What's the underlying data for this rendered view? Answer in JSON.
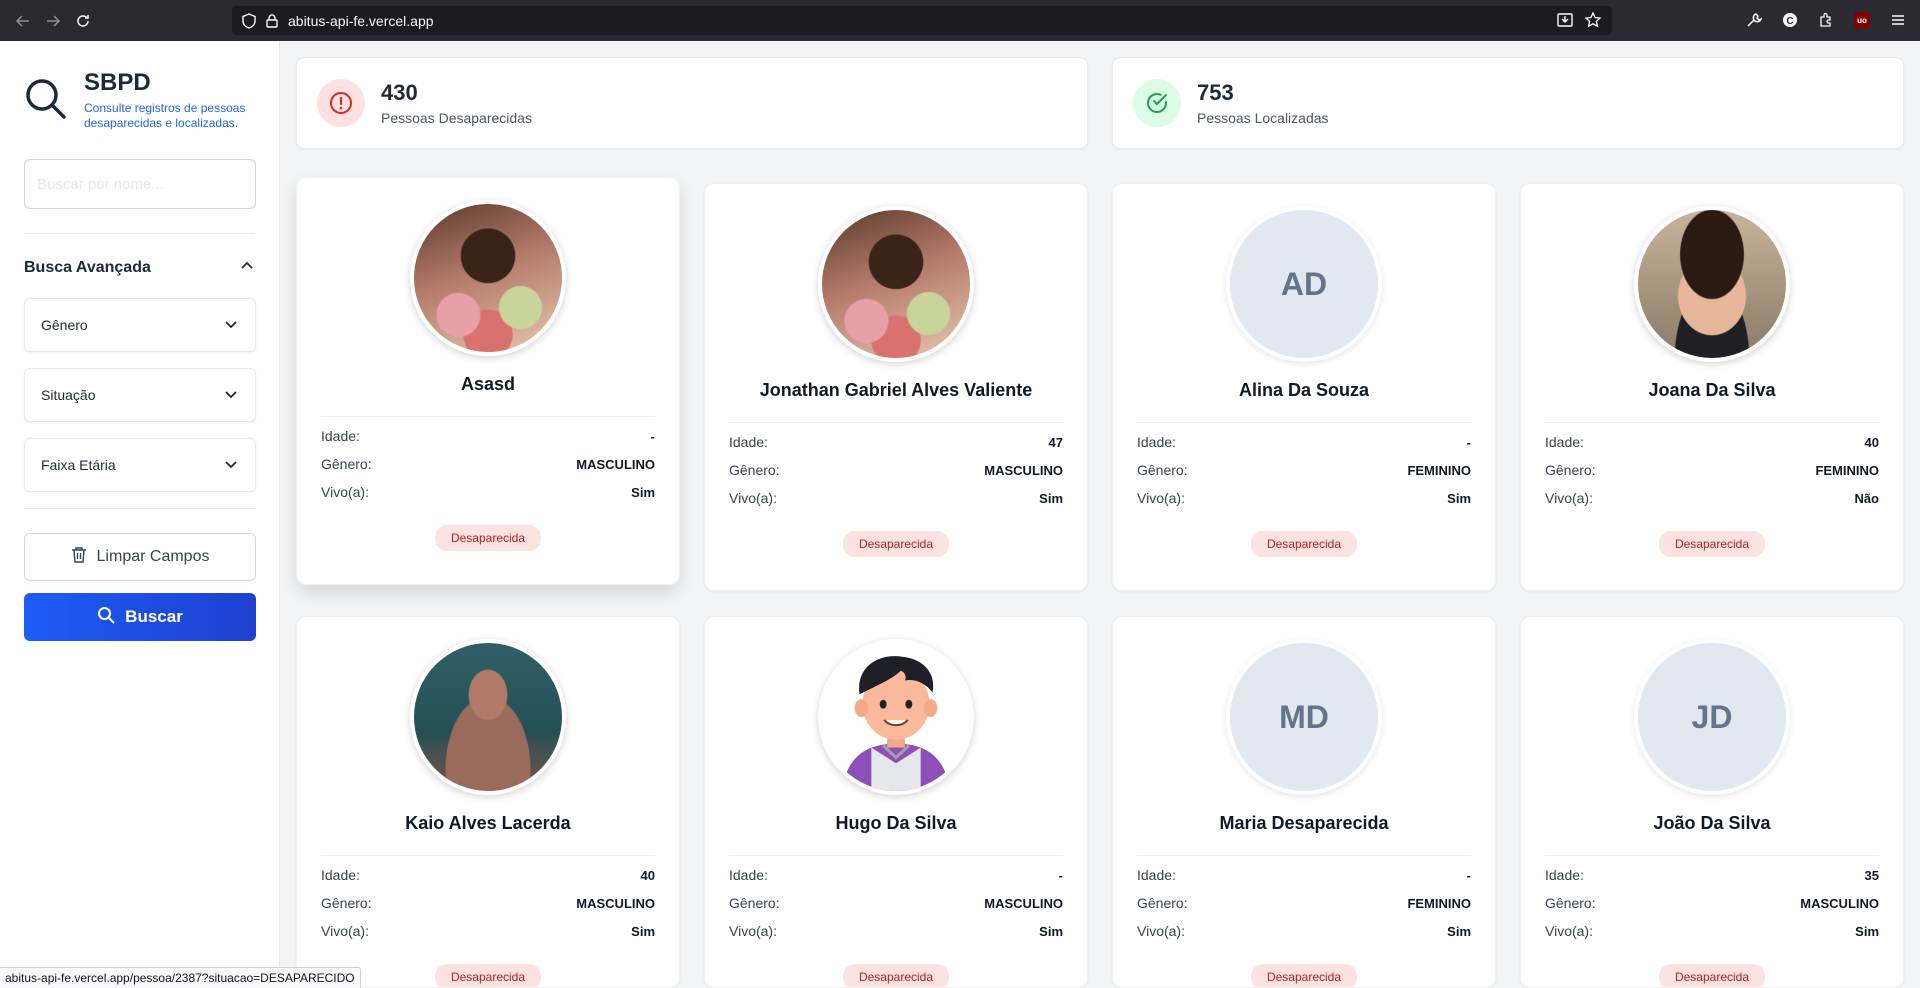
{
  "browser": {
    "url": "abitus-api-fe.vercel.app",
    "status_url": "abitus-api-fe.vercel.app/pessoa/2387?situacao=DESAPARECIDO"
  },
  "sidebar": {
    "title": "SBPD",
    "subtitle": "Consulte registros de pessoas desaparecidas e localizadas.",
    "search_placeholder": "Buscar por nome...",
    "advanced_label": "Busca Avançada",
    "filters": [
      "Gênero",
      "Situação",
      "Faixa Etária"
    ],
    "clear_label": "Limpar Campos",
    "search_label": "Buscar"
  },
  "stats": {
    "missing": {
      "value": "430",
      "label": "Pessoas Desaparecidas",
      "color": "#dc2626"
    },
    "found": {
      "value": "753",
      "label": "Pessoas Localizadas",
      "color": "#16a34a"
    }
  },
  "labels": {
    "age": "Idade:",
    "gender": "Gênero:",
    "alive": "Vivo(a):"
  },
  "cards": [
    {
      "name": "Asasd",
      "age": "-",
      "gender": "MASCULINO",
      "alive": "Sim",
      "status": "Desaparecida",
      "avatar": "photo-floral"
    },
    {
      "name": "Jonathan Gabriel Alves Valiente",
      "age": "47",
      "gender": "MASCULINO",
      "alive": "Sim",
      "status": "Desaparecida",
      "avatar": "photo-floral"
    },
    {
      "name": "Alina Da Souza",
      "age": "-",
      "gender": "FEMININO",
      "alive": "Sim",
      "status": "Desaparecida",
      "initials": "AD"
    },
    {
      "name": "Joana Da Silva",
      "age": "40",
      "gender": "FEMININO",
      "alive": "Não",
      "status": "Desaparecida",
      "avatar": "photo-man"
    },
    {
      "name": "Kaio Alves Lacerda",
      "age": "40",
      "gender": "MASCULINO",
      "alive": "Sim",
      "status": "Desaparecida",
      "avatar": "photo-outdoor"
    },
    {
      "name": "Hugo Da Silva",
      "age": "-",
      "gender": "MASCULINO",
      "alive": "Sim",
      "status": "Desaparecida",
      "avatar": "cartoon-boy"
    },
    {
      "name": "Maria Desaparecida",
      "age": "-",
      "gender": "FEMININO",
      "alive": "Sim",
      "status": "Desaparecida",
      "initials": "MD"
    },
    {
      "name": "João Da Silva",
      "age": "35",
      "gender": "MASCULINO",
      "alive": "Sim",
      "status": "Desaparecida",
      "initials": "JD"
    }
  ]
}
